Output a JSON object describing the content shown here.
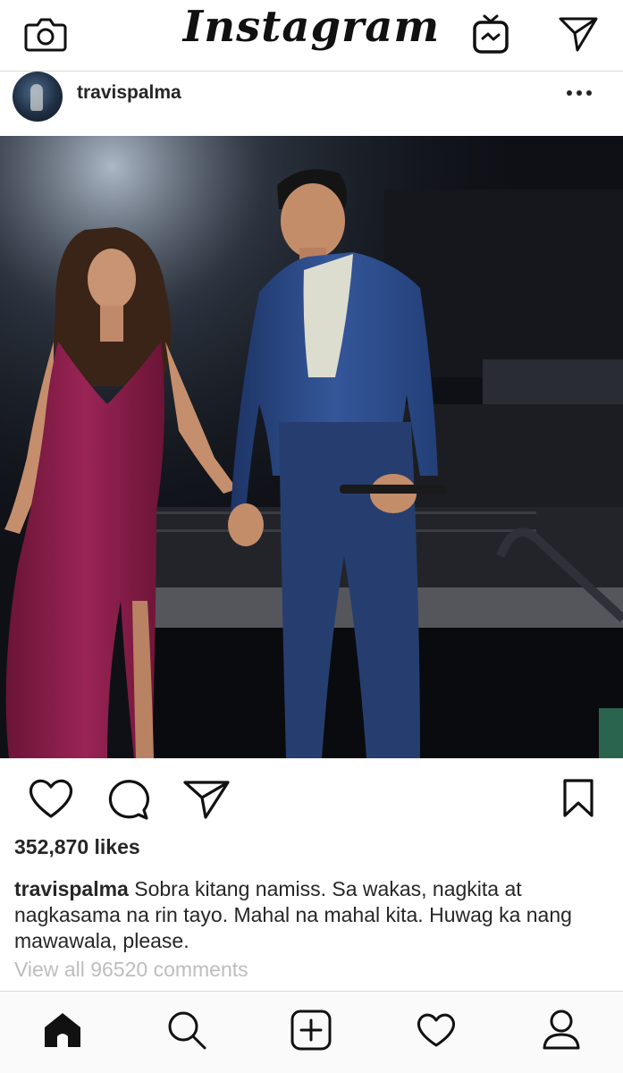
{
  "header": {
    "logo_text": "Instagram",
    "icons": [
      "camera-icon",
      "igtv-icon",
      "direct-message-icon"
    ]
  },
  "post": {
    "username": "travispalma",
    "menu_icon": "more-icon",
    "likes": "352,870 likes",
    "caption_user": "travispalma",
    "caption_text": "Sobra kitang namiss. Sa wakas, nagkita at nagkasama na rin tayo. Mahal na mahal kita. Huwag ka nang mawawala, please.",
    "view_comments": "View all 96520 comments",
    "actions": [
      "heart-icon",
      "comment-icon",
      "share-icon",
      "bookmark-icon"
    ]
  },
  "bottom_nav": {
    "items": [
      "home-icon",
      "search-icon",
      "add-post-icon",
      "activity-heart-icon",
      "profile-icon"
    ]
  },
  "colors": {
    "text": "#262626",
    "muted": "#bdbdbd",
    "divider": "#dbdbdb",
    "dress": "#8a1e4a",
    "suit": "#2c4a86"
  }
}
